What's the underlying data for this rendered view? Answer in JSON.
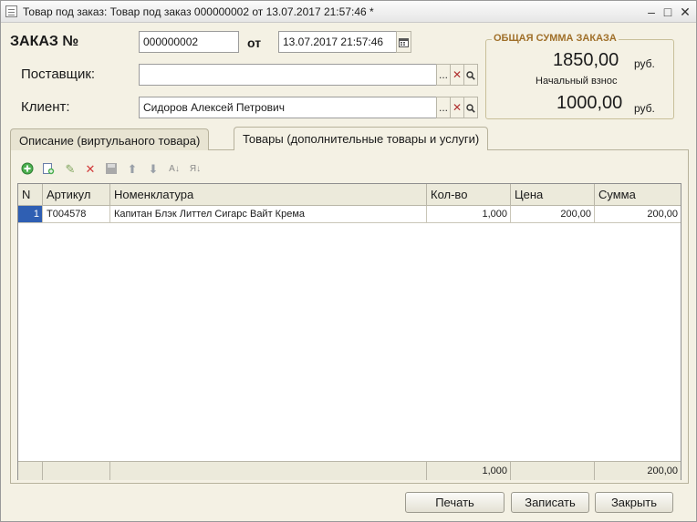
{
  "window": {
    "title": "Товар под заказ: Товар под заказ 000000002 от 13.07.2017 21:57:46 *"
  },
  "header": {
    "order_label": "ЗАКАЗ №",
    "order_number": "000000002",
    "date_label": "от",
    "order_date": "13.07.2017 21:57:46",
    "supplier_label": "Поставщик:",
    "supplier_value": "",
    "client_label": "Клиент:",
    "client_value": "Сидоров Алексей Петрович",
    "choose_symbol": "...",
    "clear_symbol": "✕"
  },
  "summary": {
    "title": "ОБЩАЯ СУММА ЗАКАЗА",
    "total": "1850,00",
    "total_unit": "руб.",
    "deposit_label": "Начальный взнос",
    "deposit": "1000,00",
    "deposit_unit": "руб."
  },
  "tabs": [
    {
      "label": "Описание (виртульаного товара)",
      "active": false
    },
    {
      "label": "Товары (дополнительные товары и услуги)",
      "active": true
    }
  ],
  "table": {
    "columns": [
      "N",
      "Артикул",
      "Номенклатура",
      "Кол-во",
      "Цена",
      "Сумма"
    ],
    "rows": [
      {
        "n": "1",
        "article": "Т004578",
        "name": "Капитан Блэк Литтел Сигарс Вайт Крема",
        "qty": "1,000",
        "price": "200,00",
        "sum": "200,00"
      }
    ],
    "footer": {
      "qty": "1,000",
      "sum": "200,00"
    }
  },
  "buttons": {
    "print": "Печать",
    "save": "Записать",
    "close": "Закрыть"
  },
  "colors": {
    "panel": "#f4f1e4",
    "accent": "#a0702a",
    "selection": "#2f5fb3"
  }
}
